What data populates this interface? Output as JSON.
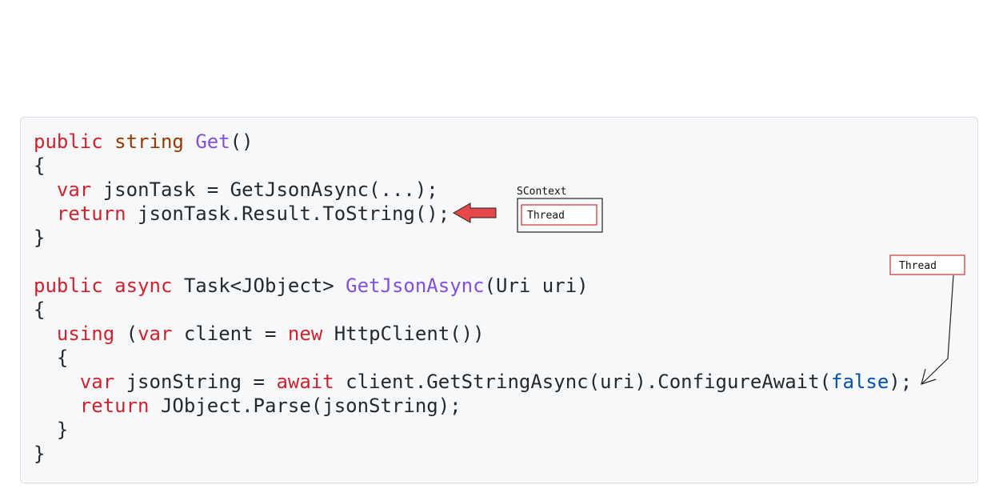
{
  "code": {
    "lines": [
      [
        {
          "t": "public",
          "c": "kw"
        },
        {
          "t": " "
        },
        {
          "t": "string",
          "c": "ty"
        },
        {
          "t": " "
        },
        {
          "t": "Get",
          "c": "fn"
        },
        {
          "t": "()"
        }
      ],
      [
        {
          "t": "{"
        }
      ],
      [
        {
          "t": "  "
        },
        {
          "t": "var",
          "c": "kw"
        },
        {
          "t": " jsonTask = GetJsonAsync(...);"
        }
      ],
      [
        {
          "t": "  "
        },
        {
          "t": "return",
          "c": "kw"
        },
        {
          "t": " jsonTask.Result.ToString();"
        }
      ],
      [
        {
          "t": "}"
        }
      ],
      [
        {
          "t": ""
        }
      ],
      [
        {
          "t": "public",
          "c": "kw"
        },
        {
          "t": " "
        },
        {
          "t": "async",
          "c": "kw"
        },
        {
          "t": " Task<JObject> "
        },
        {
          "t": "GetJsonAsync",
          "c": "fn"
        },
        {
          "t": "(Uri uri)"
        }
      ],
      [
        {
          "t": "{"
        }
      ],
      [
        {
          "t": "  "
        },
        {
          "t": "using",
          "c": "kw"
        },
        {
          "t": " ("
        },
        {
          "t": "var",
          "c": "kw"
        },
        {
          "t": " client = "
        },
        {
          "t": "new",
          "c": "kw"
        },
        {
          "t": " HttpClient())"
        }
      ],
      [
        {
          "t": "  {"
        }
      ],
      [
        {
          "t": "    "
        },
        {
          "t": "var",
          "c": "kw"
        },
        {
          "t": " jsonString = "
        },
        {
          "t": "await",
          "c": "kw"
        },
        {
          "t": " client.GetStringAsync(uri).ConfigureAwait("
        },
        {
          "t": "false",
          "c": "lit"
        },
        {
          "t": ");"
        }
      ],
      [
        {
          "t": "    "
        },
        {
          "t": "return",
          "c": "kw"
        },
        {
          "t": " JObject.Parse(jsonString);"
        }
      ],
      [
        {
          "t": "  }"
        }
      ],
      [
        {
          "t": "}"
        }
      ]
    ]
  },
  "annotations": {
    "context_label": "SContext",
    "context_thread_label": "Thread",
    "free_thread_label": "Thread"
  },
  "colors": {
    "block_arrow_fill": "#e8474a",
    "thread_box_stroke": "#d32f2f"
  }
}
